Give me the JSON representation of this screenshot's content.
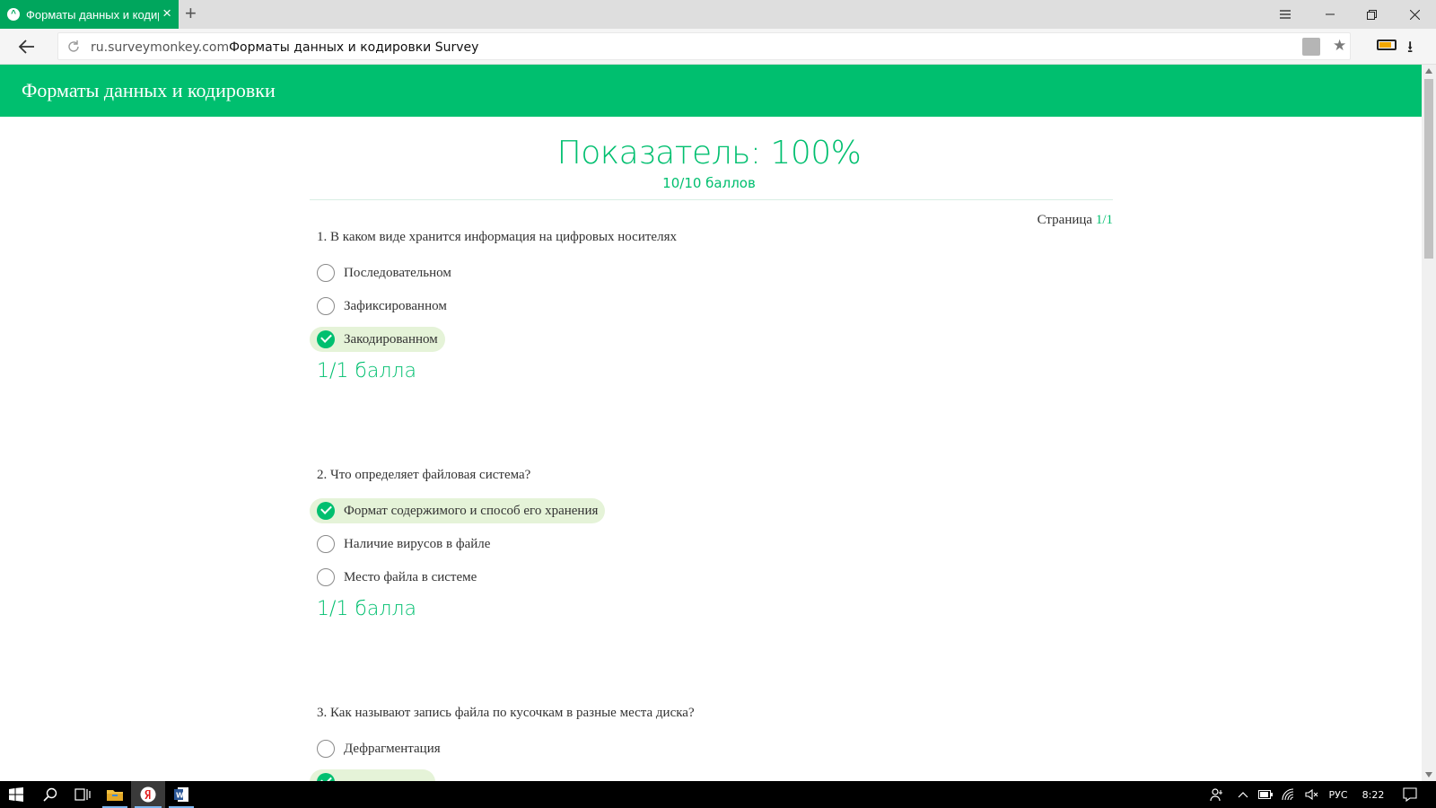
{
  "browser": {
    "tab_title": "Форматы данных и кодиров",
    "url_domain": "ru.surveymonkey.com",
    "url_title": "Форматы данных и кодировки Survey",
    "accent_color": "#00a65d"
  },
  "survey": {
    "header_title": "Форматы данных и кодировки",
    "score_title": "Показатель: 100%",
    "score_subtitle": "10/10 баллов",
    "page_label": "Страница",
    "page_value": "1/1",
    "brand_color": "#00bf6f"
  },
  "questions": [
    {
      "text": "1. В каком виде хранится информация на цифровых носителях",
      "options": [
        {
          "label": "Последовательном",
          "selected": false
        },
        {
          "label": "Зафиксированном",
          "selected": false
        },
        {
          "label": "Закодированном",
          "selected": true
        }
      ],
      "score": "1/1 балла"
    },
    {
      "text": "2. Что определяет файловая система?",
      "options": [
        {
          "label": "Формат содержимого и способ его хранения",
          "selected": true
        },
        {
          "label": "Наличие вирусов в файле",
          "selected": false
        },
        {
          "label": "Место файла в системе",
          "selected": false
        }
      ],
      "score": "1/1 балла"
    },
    {
      "text": "3. Как называют запись файла по кусочкам в разные места диска?",
      "options": [
        {
          "label": "Дефрагментация",
          "selected": false
        }
      ]
    }
  ],
  "taskbar": {
    "lang": "РУС",
    "time": "8:22",
    "icons": [
      "windows-start-icon",
      "search-icon",
      "task-view-icon",
      "file-explorer-icon",
      "yandex-browser-icon",
      "word-icon"
    ]
  }
}
